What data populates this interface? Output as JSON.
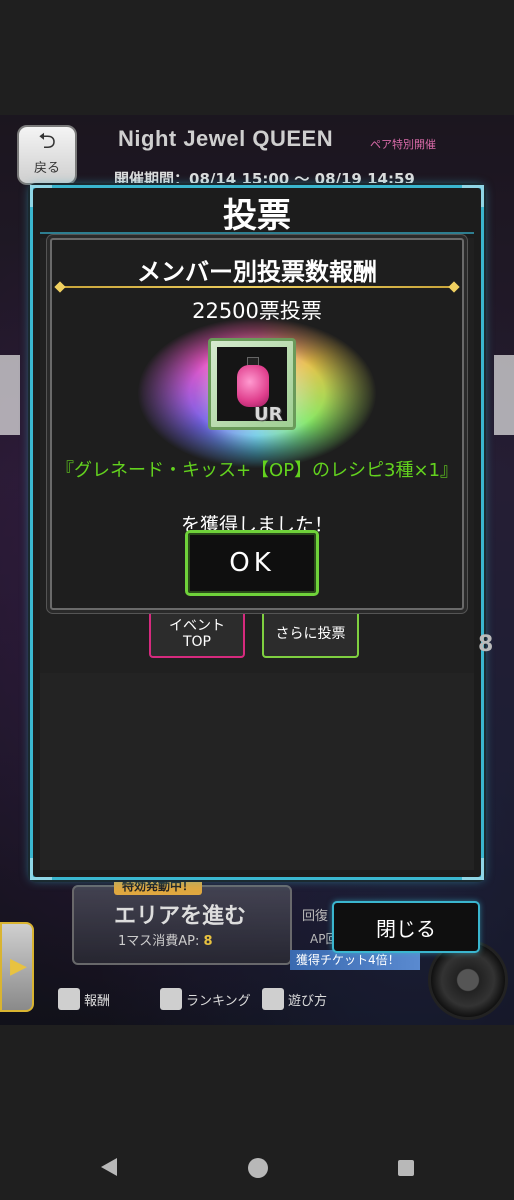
{
  "event": {
    "back_label": "戻る",
    "title": "Night Jewel QUEEN",
    "title_suffix": "ペア特別開催",
    "period": "開催期間：08/14 15:00 ～ 08/19 14:59"
  },
  "vote_dialog": {
    "title": "投票",
    "event_top_label": "イベント\nTOP",
    "vote_more_label": "さらに投票",
    "side_count": "8"
  },
  "reward_popup": {
    "title": "メンバー別投票数報酬",
    "votes": "22500票投票",
    "rarity": "UR",
    "item_text": "『グレネード・キッス+【OP】のレシピ3種×1』",
    "acquired_text": "を獲得しました！",
    "ok_label": "OK"
  },
  "hud": {
    "special_badge": "特効発動中！",
    "area_label": "エリアを進む",
    "cost_label": "1マス消費AP:",
    "cost_value": "8",
    "recover_label": "回復",
    "ap_label": "AP回",
    "ticket_label": "獲得チケット4倍！",
    "nav_reward": "報酬",
    "nav_ranking": "ランキング",
    "nav_help": "遊び方"
  },
  "close_label": "閉じる",
  "colors": {
    "accent_cyan": "#3ab6cf",
    "ok_green": "#6fd23a",
    "item_green": "#63d21e",
    "event_pink": "#d62a7e"
  },
  "icons": [
    "back-arrow-icon",
    "android-back-icon",
    "android-home-icon",
    "android-recents-icon"
  ]
}
